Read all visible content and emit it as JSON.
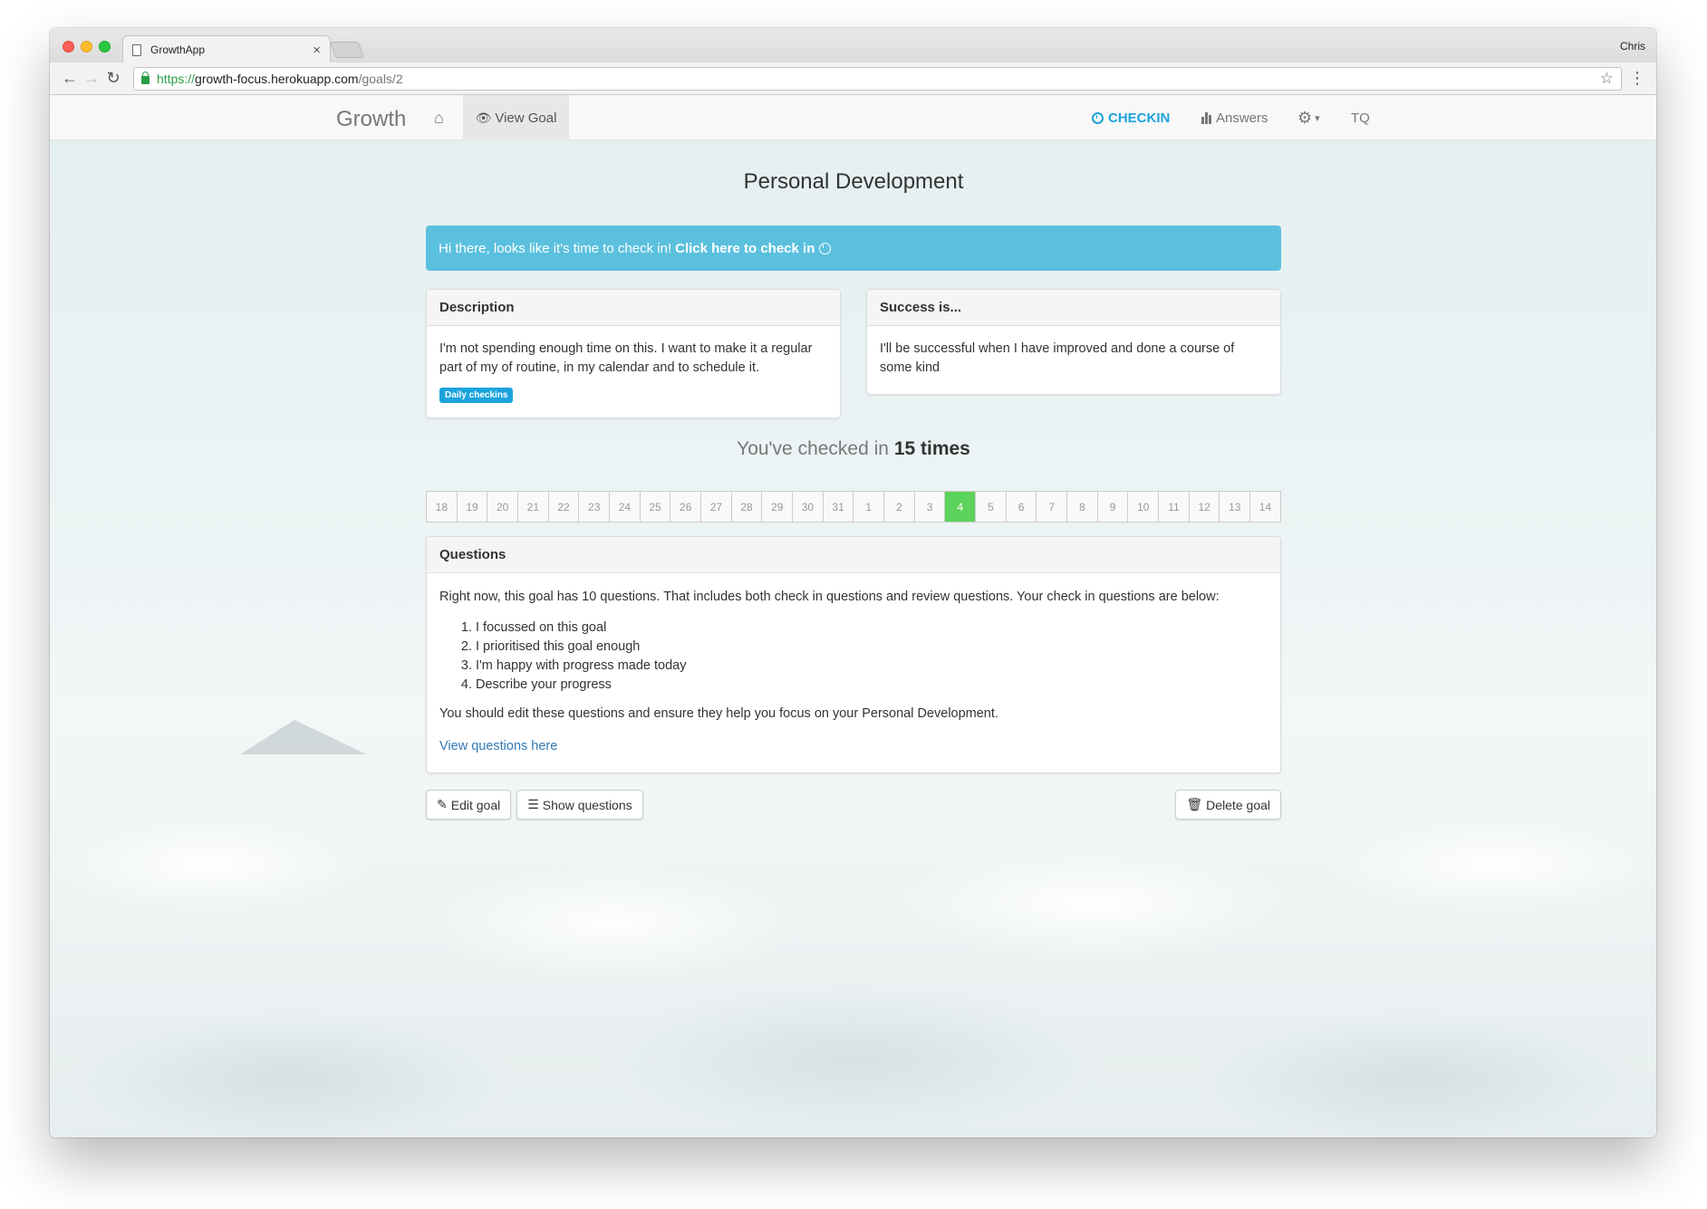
{
  "browser": {
    "tab_title": "GrowthApp",
    "tab_close": "×",
    "profile_name": "Chris",
    "url_protocol": "https://",
    "url_host": "growth-focus.herokuapp.com",
    "url_path": "/goals/2",
    "back": "←",
    "forward": "→",
    "reload": "↻",
    "star": "☆",
    "menu": "⋮"
  },
  "navbar": {
    "brand": "Growth",
    "home_icon": "⌂",
    "view_goal_icon": "👁",
    "view_goal_label": "View Goal",
    "checkin_label": "CHECKIN",
    "answers_label": "Answers",
    "settings_icon": "⚙",
    "settings_caret": "▾",
    "user_initials": "TQ",
    "accent_color": "#1ba3dd"
  },
  "goal": {
    "title": "Personal Development",
    "alert_text": "Hi there, looks like it's time to check in!",
    "alert_link": "Click here to check in",
    "description_heading": "Description",
    "description_text": "I'm not spending enough time on this. I want to make it a regular part of my of routine, in my calendar and to schedule it.",
    "frequency_badge": "Daily checkins",
    "success_heading": "Success is...",
    "success_text": "I'll be successful when I have improved and done a course of some kind",
    "checkin_prefix": "You've checked in",
    "checkin_count": "15 times"
  },
  "calendar": {
    "days": [
      "18",
      "19",
      "20",
      "21",
      "22",
      "23",
      "24",
      "25",
      "26",
      "27",
      "28",
      "29",
      "30",
      "31",
      "1",
      "2",
      "3",
      "4",
      "5",
      "6",
      "7",
      "8",
      "9",
      "10",
      "11",
      "12",
      "13",
      "14"
    ],
    "active_day": "4",
    "active_color": "#5cd35c"
  },
  "questions": {
    "heading": "Questions",
    "intro": "Right now, this goal has 10 questions. That includes both check in questions and review questions. Your check in questions are below:",
    "items": [
      "I focussed on this goal",
      "I prioritised this goal enough",
      "I'm happy with progress made today",
      "Describe your progress"
    ],
    "note": "You should edit these questions and ensure they help you focus on your Personal Development.",
    "link": "View questions here"
  },
  "actions": {
    "edit_icon": "✎",
    "edit_label": "Edit goal",
    "show_icon": "☰",
    "show_label": "Show questions",
    "delete_icon": "🗑",
    "delete_label": "Delete goal"
  }
}
